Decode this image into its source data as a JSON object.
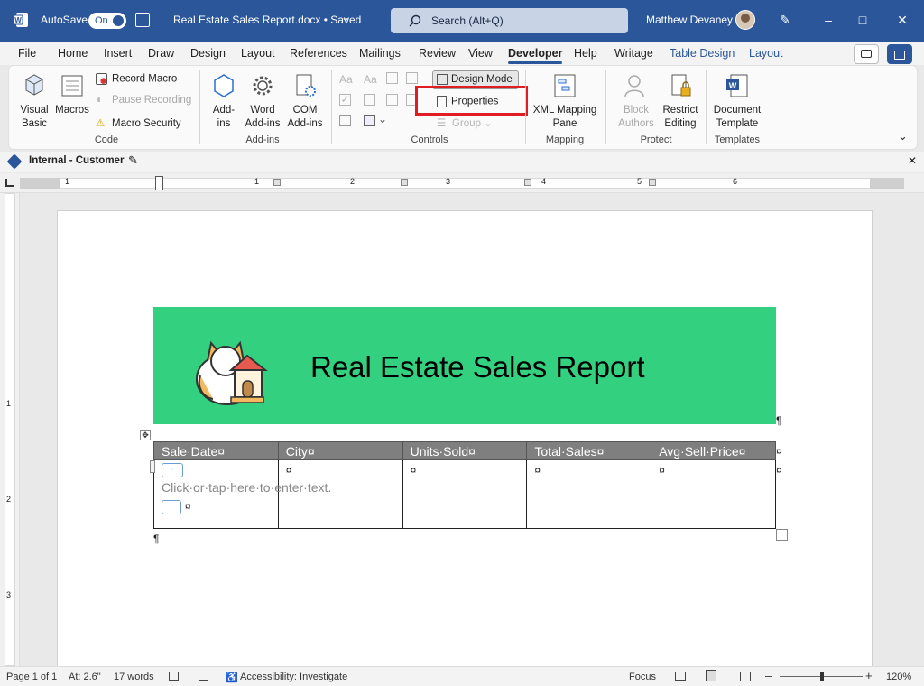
{
  "titlebar": {
    "autosave": "AutoSave",
    "toggle": "On",
    "doc_title": "Real Estate Sales Report.docx • Saved",
    "title_caret": "⌄",
    "search_placeholder": "Search (Alt+Q)",
    "user": "Matthew Devaney"
  },
  "tabs": [
    "File",
    "Home",
    "Insert",
    "Draw",
    "Design",
    "Layout",
    "References",
    "Mailings",
    "Review",
    "View",
    "Developer",
    "Help",
    "Writage",
    "Table Design",
    "Layout"
  ],
  "ribbon": {
    "code": {
      "visual_basic": "Visual\nBasic",
      "macros": "Macros",
      "record_macro": "Record Macro",
      "pause_recording": "Pause Recording",
      "macro_security": "Macro Security",
      "group": "Code"
    },
    "addins": {
      "addins": "Add-\nins",
      "word_addins": "Word\nAdd-ins",
      "com_addins": "COM\nAdd-ins",
      "group": "Add-ins"
    },
    "controls": {
      "design_mode": "Design Mode",
      "properties": "Properties",
      "group_btn": "Group",
      "group": "Controls"
    },
    "mapping": {
      "xml": "XML Mapping\nPane",
      "group": "Mapping"
    },
    "protect": {
      "block": "Block\nAuthors",
      "restrict": "Restrict\nEditing",
      "group": "Protect"
    },
    "templates": {
      "doc_template": "Document\nTemplate",
      "group": "Templates"
    }
  },
  "sensitivity": {
    "label": "Internal - Customer"
  },
  "ruler": {
    "marks": [
      "1",
      "1",
      "2",
      "3",
      "4",
      "5",
      "6"
    ],
    "vmarks": [
      "1",
      "2",
      "3"
    ]
  },
  "document": {
    "title": "Real Estate Sales Report",
    "pilcrow": "¶",
    "table": {
      "headers": [
        "Sale·Date¤",
        "City¤",
        "Units·Sold¤",
        "Total·Sales¤",
        "Avg·Sell·Price¤"
      ],
      "row_end": "¤",
      "cell_mark": "¤",
      "placeholder": "Click·or·tap·here·to·enter·text."
    }
  },
  "status": {
    "page": "Page 1 of 1",
    "at": "At: 2.6\"",
    "words": "17 words",
    "accessibility": "Accessibility: Investigate",
    "focus": "Focus",
    "zoom": "120%"
  },
  "colors": {
    "brand": "#2b579a",
    "banner": "#33d17f",
    "highlight": "#e11d24"
  }
}
